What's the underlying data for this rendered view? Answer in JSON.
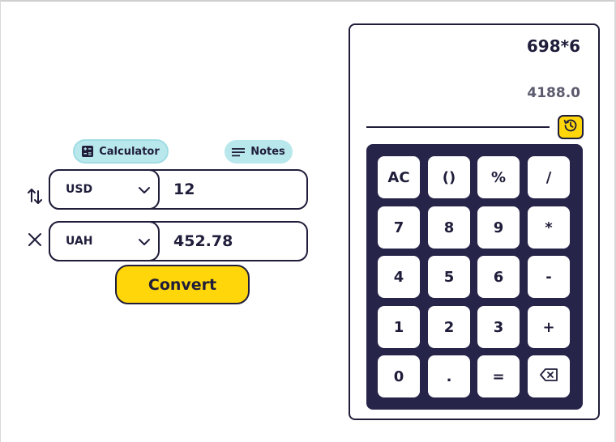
{
  "tabs": {
    "calculator_label": "Calculator",
    "notes_label": "Notes",
    "calculator_icon": "calculator-icon",
    "notes_icon": "notes-lines-icon"
  },
  "converter": {
    "swap_icon": "swap-vertical-icon",
    "clear_icon": "close-icon",
    "from": {
      "currency": "USD",
      "amount": "12"
    },
    "to": {
      "currency": "UAH",
      "amount": "452.78"
    },
    "convert_label": "Convert"
  },
  "calculator": {
    "expression": "698*6",
    "result": "4188.0",
    "history_icon": "history-icon",
    "keys": [
      [
        "AC",
        "()",
        "%",
        "/"
      ],
      [
        "7",
        "8",
        "9",
        "*"
      ],
      [
        "4",
        "5",
        "6",
        "-"
      ],
      [
        "1",
        "2",
        "3",
        "+"
      ],
      [
        "0",
        ".",
        "=",
        "backspace-icon"
      ]
    ]
  },
  "colors": {
    "accent_yellow": "#ffd60a",
    "tab_cyan": "#b8e7ec",
    "keypad_navy": "#27244a",
    "text_dark": "#1f1d3a"
  }
}
